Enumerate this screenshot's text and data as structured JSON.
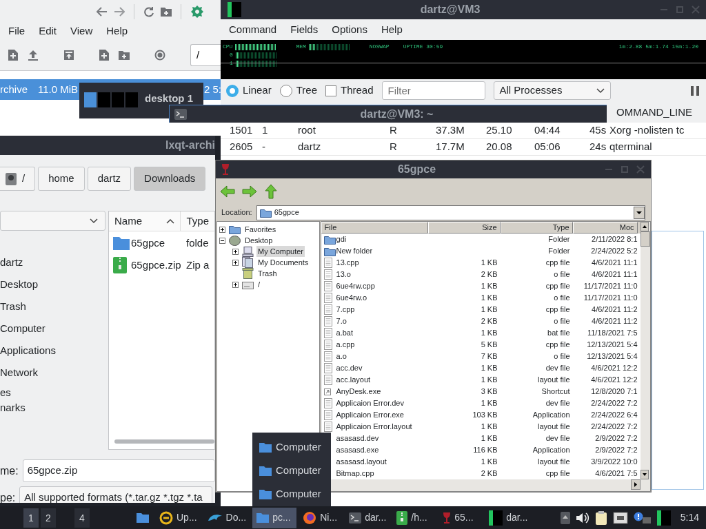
{
  "archiver": {
    "menu": [
      "File",
      "Edit",
      "View",
      "Help"
    ],
    "path": "/",
    "row": {
      "selected": true,
      "cells": [
        "rchive",
        "11.0 MiB",
        "2 5:"
      ]
    }
  },
  "process_viewer": {
    "title": "dartz@VM3",
    "menu": [
      "Command",
      "Fields",
      "Options",
      "Help"
    ],
    "meters": {
      "cpu": {
        "label": "CPU",
        "level": 1
      },
      "mem": {
        "label": "MEM",
        "level": 0.15
      },
      "swap": "NOSWAP",
      "uptime": "UPTIME 30:59",
      "load": "1m:2.88 5m:1.74 15m:1.20",
      "cores": [
        {
          "label": "0",
          "level": 0.1
        },
        {
          "label": "1",
          "level": 0.1
        }
      ]
    },
    "view_modes": [
      {
        "label": "Linear",
        "selected": true
      },
      {
        "label": "Tree",
        "selected": false
      }
    ],
    "thread": {
      "label": "Thread",
      "checked": false
    },
    "filter": {
      "placeholder": "Filter"
    },
    "scope": "All Processes",
    "header_tail": "OMMAND_LINE",
    "rows": [
      [
        "1501",
        "1",
        "root",
        "R",
        "37.3M",
        "25.10",
        "04:44",
        "45s",
        "Xorg -nolisten tc"
      ],
      [
        "2605",
        "-",
        "dartz",
        "R",
        "17.7M",
        "20.08",
        "05:06",
        "24s",
        "qterminal"
      ]
    ]
  },
  "pager": {
    "desktops": [
      {
        "selected": true
      },
      {
        "selected": false
      },
      {
        "selected": false
      },
      {
        "selected": false
      }
    ],
    "label": "desktop 1"
  },
  "terminal": {
    "title": "dartz@VM3: ~"
  },
  "file_dialog": {
    "title": "lxqt-archi",
    "breadcrumb": [
      {
        "label": "/",
        "kind": "root",
        "selected": false
      },
      {
        "label": "home",
        "selected": false
      },
      {
        "label": "dartz",
        "selected": false
      },
      {
        "label": "Downloads",
        "selected": true
      }
    ],
    "places": [
      "dartz",
      "Desktop",
      "Trash",
      "Computer",
      "Applications",
      "Network"
    ],
    "sections": [
      "es",
      "narks"
    ],
    "columns": [
      "Name",
      "Type"
    ],
    "files": [
      {
        "name": "65gpce",
        "type": "folde",
        "kind": "folder"
      },
      {
        "name": "65gpce.zip",
        "type": "Zip a",
        "kind": "zip"
      }
    ],
    "name_label": "me:",
    "name_value": "65gpce.zip",
    "type_label": "pe:",
    "type_value": "All supported formats (*.tar.gz *.tgz *.ta"
  },
  "wine_explorer": {
    "title": "65gpce",
    "location_label": "Location:",
    "location": "65gpce",
    "tree": [
      {
        "label": "Favorites",
        "kind": "folder",
        "expanded": false,
        "selected": false
      },
      {
        "label": "Desktop",
        "kind": "desktop",
        "expanded": true,
        "selected": false,
        "children": [
          {
            "label": "My Computer",
            "kind": "computer",
            "expanded": false,
            "selected": true
          },
          {
            "label": "My Documents",
            "kind": "documents",
            "expanded": false,
            "selected": false
          },
          {
            "label": "Trash",
            "kind": "trash",
            "selected": false
          },
          {
            "label": "/",
            "kind": "drive",
            "expanded": false,
            "selected": false
          }
        ]
      }
    ],
    "columns": [
      "File",
      "Size",
      "Type",
      "Moc"
    ],
    "rows": [
      {
        "kind": "folder",
        "cells": [
          "gdi",
          "",
          "Folder",
          "2/11/2022 8:1"
        ]
      },
      {
        "kind": "folder",
        "cells": [
          "New folder",
          "",
          "Folder",
          "2/24/2022 5:2"
        ]
      },
      {
        "kind": "file",
        "cells": [
          "13.cpp",
          "1 KB",
          "cpp file",
          "4/6/2021 11:1"
        ]
      },
      {
        "kind": "file",
        "cells": [
          "13.o",
          "2 KB",
          "o file",
          "4/6/2021 11:1"
        ]
      },
      {
        "kind": "file",
        "cells": [
          "6ue4rw.cpp",
          "1 KB",
          "cpp file",
          "11/17/2021 11:0"
        ]
      },
      {
        "kind": "file",
        "cells": [
          "6ue4rw.o",
          "1 KB",
          "o file",
          "11/17/2021 11:0"
        ]
      },
      {
        "kind": "file",
        "cells": [
          "7.cpp",
          "1 KB",
          "cpp file",
          "4/6/2021 11:2"
        ]
      },
      {
        "kind": "file",
        "cells": [
          "7.o",
          "2 KB",
          "o file",
          "4/6/2021 11:2"
        ]
      },
      {
        "kind": "file",
        "cells": [
          "a.bat",
          "1 KB",
          "bat file",
          "11/18/2021 7:5"
        ]
      },
      {
        "kind": "file",
        "cells": [
          "a.cpp",
          "5 KB",
          "cpp file",
          "12/13/2021 5:4"
        ]
      },
      {
        "kind": "file",
        "cells": [
          "a.o",
          "7 KB",
          "o file",
          "12/13/2021 5:4"
        ]
      },
      {
        "kind": "file",
        "cells": [
          "acc.dev",
          "1 KB",
          "dev file",
          "4/6/2021 12:2"
        ]
      },
      {
        "kind": "file",
        "cells": [
          "acc.layout",
          "1 KB",
          "layout file",
          "4/6/2021 12:2"
        ]
      },
      {
        "kind": "shortcut",
        "cells": [
          "AnyDesk.exe",
          "3 KB",
          "Shortcut",
          "12/8/2020 7:1"
        ]
      },
      {
        "kind": "file",
        "cells": [
          "Applicaion Error.dev",
          "1 KB",
          "dev file",
          "2/24/2022 7:2"
        ]
      },
      {
        "kind": "file",
        "cells": [
          "Applicaion Error.exe",
          "103 KB",
          "Application",
          "2/24/2022 6:4"
        ]
      },
      {
        "kind": "file",
        "cells": [
          "Applicaion Error.layout",
          "1 KB",
          "layout file",
          "2/24/2022 7:2"
        ]
      },
      {
        "cells": [
          "asasasd.dev",
          "1 KB",
          "dev file",
          "2/9/2022 7:2"
        ]
      },
      {
        "cells": [
          "asasasd.exe",
          "116 KB",
          "Application",
          "2/9/2022 7:2"
        ]
      },
      {
        "cells": [
          "asasasd.layout",
          "1 KB",
          "layout file",
          "3/9/2022 10:0"
        ]
      },
      {
        "cells": [
          "Bitmap.cpp",
          "2 KB",
          "cpp file",
          "4/6/2021 7:5"
        ]
      }
    ]
  },
  "popup_menu": {
    "items": [
      "Computer",
      "Computer",
      "Computer"
    ]
  },
  "taskbar": {
    "desktops": [
      {
        "label": "1",
        "selected": true
      },
      {
        "label": "2",
        "selected": false
      },
      {
        "label": "4",
        "selected": false
      }
    ],
    "tasks": [
      {
        "kind": "folder",
        "selected": false
      },
      {
        "kind": "ring",
        "label": "Up...",
        "selected": false
      },
      {
        "kind": "dolphin",
        "label": "Do...",
        "selected": false
      },
      {
        "kind": "folder",
        "label": "pc...",
        "selected": true
      },
      {
        "kind": "browser",
        "label": "Ni...",
        "selected": false
      },
      {
        "kind": "terminal",
        "label": "dar...",
        "selected": false
      },
      {
        "kind": "zip",
        "label": "/h...",
        "selected": false
      },
      {
        "kind": "wine",
        "label": "65...",
        "selected": false
      },
      {
        "kind": "monitor",
        "label": "dar...",
        "selected": false
      }
    ],
    "clock": "5:14"
  }
}
